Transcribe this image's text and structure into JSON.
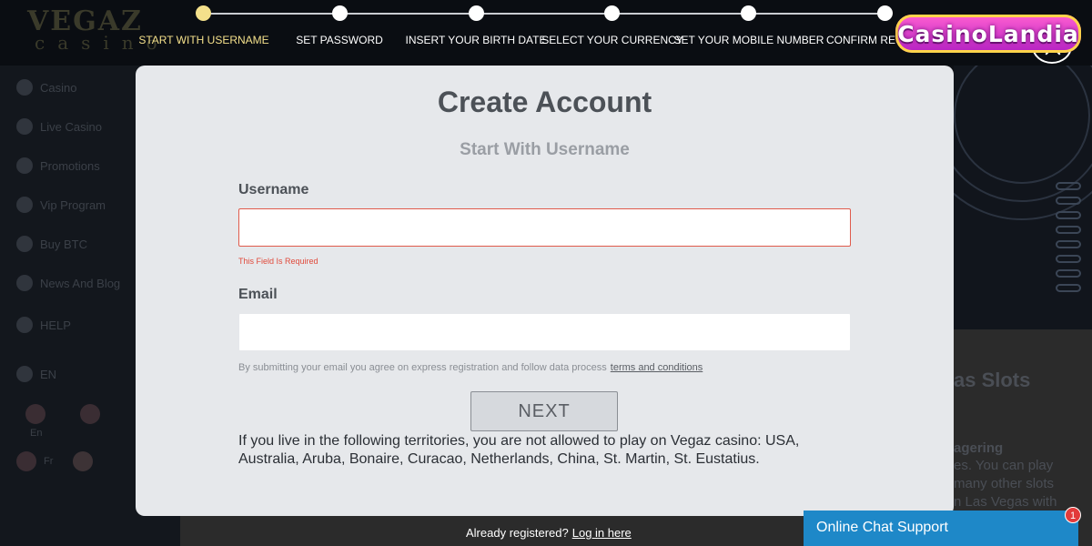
{
  "background": {
    "logo": {
      "line1": "VEGAZ",
      "line2": "casino"
    },
    "sidebar": [
      {
        "label": "Casino"
      },
      {
        "label": "Live Casino"
      },
      {
        "label": "Promotions"
      },
      {
        "label": "Vip Program"
      },
      {
        "label": "Buy BTC"
      },
      {
        "label": "News And Blog"
      },
      {
        "label": "HELP"
      },
      {
        "label": "EN"
      }
    ],
    "languages": [
      "En",
      "Fr"
    ],
    "hero_snippets": [
      "as Slots",
      "agering",
      "es. You can play",
      "many other slots",
      "n Las Vegas with"
    ]
  },
  "stepper": {
    "steps": [
      {
        "label": "START WITH USERNAME",
        "active": true
      },
      {
        "label": "SET PASSWORD",
        "active": false
      },
      {
        "label": "INSERT YOUR BIRTH DATE",
        "active": false
      },
      {
        "label": "SELECT YOUR CURRENCY",
        "active": false
      },
      {
        "label": "SET YOUR MOBILE NUMBER",
        "active": false
      },
      {
        "label": "CONFIRM REGIS",
        "active": false
      }
    ],
    "active_color": "#f4e08b"
  },
  "brand": {
    "watermark": "CasinoLandia"
  },
  "modal": {
    "title": "Create Account",
    "subtitle": "Start With Username",
    "username": {
      "label": "Username",
      "value": "",
      "error": "This Field Is Required"
    },
    "email": {
      "label": "Email",
      "value": "",
      "note": "By submitting your email you agree on express registration and follow data process",
      "terms_link": "terms and conditions"
    },
    "next_label": "NEXT",
    "territories": "If you live in the following territories, you are not allowed to play on Vegaz casino: USA, Australia, Aruba, Bonaire, Curacao, Netherlands, China, St. Martin, St. Eustatius."
  },
  "footer": {
    "already_text": "Already registered?",
    "login_link": "Log in here",
    "chat_label": "Online Chat Support",
    "chat_badge": "1"
  },
  "colors": {
    "error": "#e04a3b",
    "chat": "#1e88c8",
    "modal_bg": "#e6e8eb"
  }
}
